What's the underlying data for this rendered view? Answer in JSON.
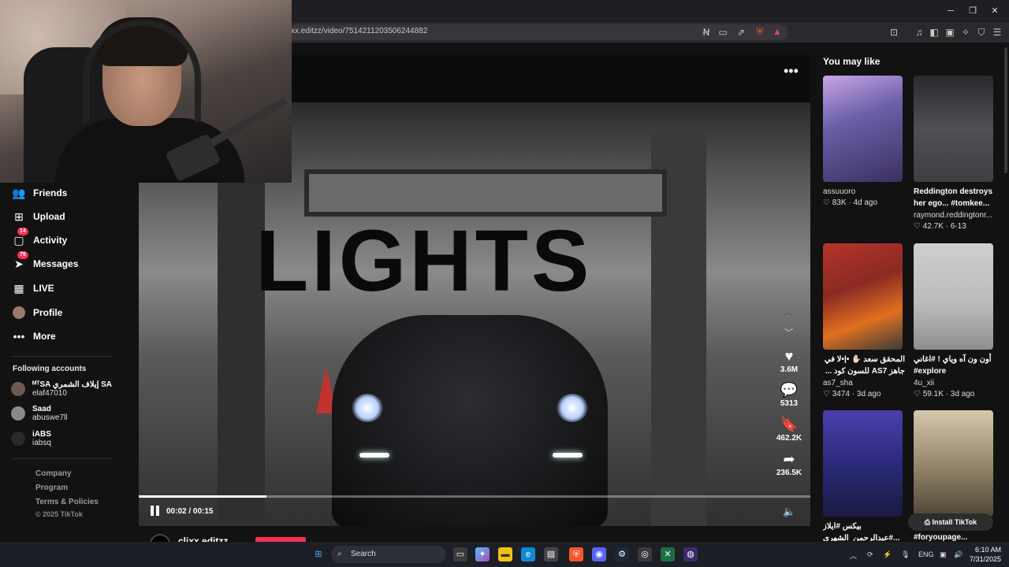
{
  "browser": {
    "url": "xx.editzz/video/7514211203506244882",
    "window_controls": [
      "minimize",
      "maximize",
      "close"
    ]
  },
  "sidebar": {
    "nav": [
      {
        "label": "Friends",
        "icon": "friends-icon"
      },
      {
        "label": "Upload",
        "icon": "upload-icon"
      },
      {
        "label": "Activity",
        "icon": "activity-icon",
        "badge": "14"
      },
      {
        "label": "Messages",
        "icon": "messages-icon",
        "badge": "79"
      },
      {
        "label": "LIVE",
        "icon": "live-icon"
      },
      {
        "label": "Profile",
        "icon": "profile-avatar-icon"
      },
      {
        "label": "More",
        "icon": "more-dots-icon"
      }
    ],
    "following_title": "Following accounts",
    "following": [
      {
        "name": "ᴹᵀSA إيلاف الشمري SA",
        "handle": "elaf47010"
      },
      {
        "name": "Saad",
        "handle": "abuswe7ll"
      },
      {
        "name": "iABS",
        "handle": "iabsq"
      }
    ],
    "footer": [
      "Company",
      "Program",
      "Terms & Policies"
    ],
    "copyright": "© 2025 TikTok"
  },
  "video": {
    "overlay_text": "LIGHTS",
    "time": "00:02 / 00:15",
    "progress": 0.19,
    "likes": "3.6M",
    "comments": "5313",
    "saves": "462.2K",
    "shares": "236.5K",
    "author": "clixx.editzz"
  },
  "recommendations": {
    "title": "You may like",
    "cards": [
      {
        "title": "",
        "author": "assuuoro",
        "likes": "83K",
        "date": "4d ago",
        "thumb_color": "#6b5fa8"
      },
      {
        "title": "Reddington destroys her ego... #tomkee...",
        "author": "raymond.reddingtonr...",
        "likes": "42.7K",
        "date": "6-13",
        "thumb_color": "#3f3f42"
      },
      {
        "title": "المحقق سعد ✋🏻 •|•ﻻ في جاهز AS7 للسون كود ...",
        "author": "as7_sha",
        "likes": "3474",
        "date": "3d ago",
        "thumb_color": "#8a2a22"
      },
      {
        "title": "أون ون آه وياي ! #اغاني #explore",
        "author": "4u_xii",
        "likes": "59.1K",
        "date": "3d ago",
        "thumb_color": "#b9b9b9"
      },
      {
        "title": "بيكس #ايلاز #عبدالرحمن_الشهري...",
        "author": "",
        "likes": "",
        "date": "",
        "thumb_color": "#2b2a7a"
      },
      {
        "title": "#foryoupage...",
        "author": "",
        "likes": "",
        "date": "",
        "thumb_color": "#8a7c63"
      }
    ],
    "install_label": "Install TikTok"
  },
  "taskbar": {
    "search_label": "Search",
    "lang": "ENG",
    "time": "6:10 AM",
    "date": "7/31/2025"
  }
}
